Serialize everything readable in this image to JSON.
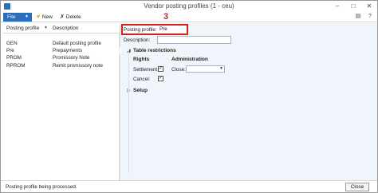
{
  "window": {
    "title": "Vendor posting profiles (1 - ceu)"
  },
  "toolbar": {
    "file_label": "File",
    "new_label": "New",
    "delete_label": "Delete"
  },
  "list": {
    "columns": [
      "Posting profile",
      "Description"
    ],
    "rows": [
      {
        "profile": "GEN",
        "description": "Default posting profile"
      },
      {
        "profile": "Pre",
        "description": "Prepayments"
      },
      {
        "profile": "PROM",
        "description": "Promissory Note"
      },
      {
        "profile": "RPROM",
        "description": "Remit promissory note"
      }
    ]
  },
  "annotation": {
    "number": "3"
  },
  "detail": {
    "posting_profile_label": "Posting profile:",
    "posting_profile_value": "Pre",
    "description_label": "Description:",
    "description_value": "",
    "table_restrictions_title": "Table restrictions",
    "rights_header": "Rights",
    "administration_header": "Administration",
    "settlement_label": "Settlement:",
    "settlement_checked": true,
    "close_label": "Close:",
    "close_value": "",
    "cancel_label": "Cancel:",
    "cancel_checked": true,
    "setup_title": "Setup"
  },
  "status": {
    "text": "Posting profile being processed.",
    "close_button": "Close"
  },
  "colors": {
    "file_button": "#2a6ebb",
    "annotation_red": "#d41f1f",
    "detail_background": "#f0f5fb"
  },
  "icons": [
    "app-icon",
    "new-icon",
    "delete-icon",
    "sort-icon",
    "collapse-icon",
    "expand-icon",
    "checkmark-icon",
    "dropdown-arrow-icon"
  ]
}
